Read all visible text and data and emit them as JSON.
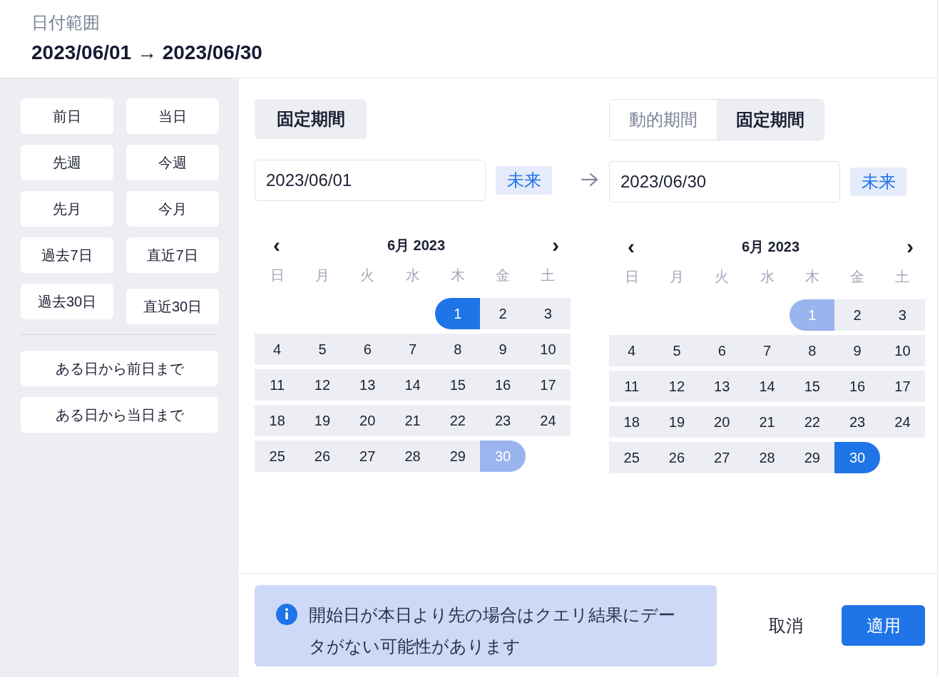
{
  "header": {
    "label": "日付範囲",
    "range": "2023/06/01 → 2023/06/30"
  },
  "sidebar": {
    "presets": [
      "前日",
      "当日",
      "先週",
      "今週",
      "先月",
      "今月",
      "過去7日",
      "直近7日",
      "過去30日",
      "直近30日"
    ],
    "ranges": [
      "ある日から前日まで",
      "ある日から当日まで"
    ]
  },
  "pickers": [
    {
      "tabs": [
        {
          "label": "固定期間",
          "selected": true
        }
      ],
      "date": "2023/06/01",
      "future": "未来",
      "month": "6月 2023",
      "prev": "‹",
      "next": "›",
      "weekdays": [
        "日",
        "月",
        "火",
        "水",
        "木",
        "金",
        "土"
      ],
      "weeks": [
        [
          {
            "label": "1",
            "kind": "start",
            "selected": true
          },
          {
            "label": "2",
            "kind": "range"
          },
          {
            "label": "3",
            "kind": "range"
          }
        ],
        [
          {
            "label": "4",
            "kind": "range"
          },
          {
            "label": "5",
            "kind": "range"
          },
          {
            "label": "6",
            "kind": "range"
          },
          {
            "label": "7",
            "kind": "range"
          },
          {
            "label": "8",
            "kind": "range"
          },
          {
            "label": "9",
            "kind": "range"
          },
          {
            "label": "10",
            "kind": "range"
          }
        ],
        [
          {
            "label": "11",
            "kind": "range"
          },
          {
            "label": "12",
            "kind": "range"
          },
          {
            "label": "13",
            "kind": "range"
          },
          {
            "label": "14",
            "kind": "range"
          },
          {
            "label": "15",
            "kind": "range"
          },
          {
            "label": "16",
            "kind": "range"
          },
          {
            "label": "17",
            "kind": "range"
          }
        ],
        [
          {
            "label": "18",
            "kind": "range"
          },
          {
            "label": "19",
            "kind": "range"
          },
          {
            "label": "20",
            "kind": "range"
          },
          {
            "label": "21",
            "kind": "range"
          },
          {
            "label": "22",
            "kind": "range"
          },
          {
            "label": "23",
            "kind": "range"
          },
          {
            "label": "24",
            "kind": "range"
          }
        ],
        [
          {
            "label": "25",
            "kind": "range"
          },
          {
            "label": "26",
            "kind": "range"
          },
          {
            "label": "27",
            "kind": "range"
          },
          {
            "label": "28",
            "kind": "range"
          },
          {
            "label": "29",
            "kind": "range"
          },
          {
            "label": "30",
            "kind": "end",
            "selected": false
          }
        ]
      ]
    },
    {
      "tabs": [
        {
          "label": "動的期間",
          "selected": false
        },
        {
          "label": "固定期間",
          "selected": true
        }
      ],
      "date": "2023/06/30",
      "future": "未来",
      "month": "6月 2023",
      "prev": "‹",
      "next": "›",
      "weekdays": [
        "日",
        "月",
        "火",
        "水",
        "木",
        "金",
        "土"
      ],
      "weeks": [
        [
          {
            "label": "1",
            "kind": "start",
            "selected": false
          },
          {
            "label": "2",
            "kind": "range"
          },
          {
            "label": "3",
            "kind": "range"
          }
        ],
        [
          {
            "label": "4",
            "kind": "range"
          },
          {
            "label": "5",
            "kind": "range"
          },
          {
            "label": "6",
            "kind": "range"
          },
          {
            "label": "7",
            "kind": "range"
          },
          {
            "label": "8",
            "kind": "range"
          },
          {
            "label": "9",
            "kind": "range"
          },
          {
            "label": "10",
            "kind": "range"
          }
        ],
        [
          {
            "label": "11",
            "kind": "range"
          },
          {
            "label": "12",
            "kind": "range"
          },
          {
            "label": "13",
            "kind": "range"
          },
          {
            "label": "14",
            "kind": "range"
          },
          {
            "label": "15",
            "kind": "range"
          },
          {
            "label": "16",
            "kind": "range"
          },
          {
            "label": "17",
            "kind": "range"
          }
        ],
        [
          {
            "label": "18",
            "kind": "range"
          },
          {
            "label": "19",
            "kind": "range"
          },
          {
            "label": "20",
            "kind": "range"
          },
          {
            "label": "21",
            "kind": "range"
          },
          {
            "label": "22",
            "kind": "range"
          },
          {
            "label": "23",
            "kind": "range"
          },
          {
            "label": "24",
            "kind": "range"
          }
        ],
        [
          {
            "label": "25",
            "kind": "range"
          },
          {
            "label": "26",
            "kind": "range"
          },
          {
            "label": "27",
            "kind": "range"
          },
          {
            "label": "28",
            "kind": "range"
          },
          {
            "label": "29",
            "kind": "range"
          },
          {
            "label": "30",
            "kind": "end",
            "selected": true
          }
        ]
      ]
    }
  ],
  "notice": "開始日が本日より先の場合はクエリ結果にデータがない可能性があります",
  "buttons": {
    "cancel": "取消",
    "apply": "適用"
  }
}
